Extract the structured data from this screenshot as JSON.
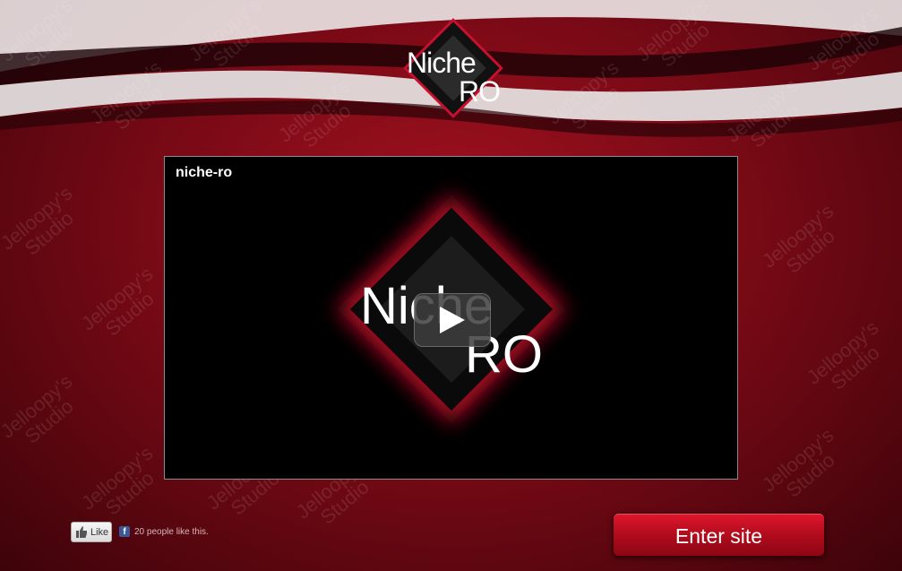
{
  "logo": {
    "line1": "Niche",
    "line2": "RO"
  },
  "video": {
    "title": "niche-ro",
    "art_line1": "Niche",
    "art_line2": "RO"
  },
  "watermark": {
    "line1": "Jelloopy's",
    "line2": "Studio"
  },
  "facebook": {
    "like_label": "Like",
    "count_text": "20 people like this.",
    "brand_letter": "f"
  },
  "enter": {
    "label": "Enter site"
  },
  "icons": {
    "play": "play-icon",
    "thumbs_up": "thumbs-up-icon",
    "facebook": "facebook-icon"
  },
  "colors": {
    "accent": "#c8102e",
    "background": "#7a0a16"
  }
}
